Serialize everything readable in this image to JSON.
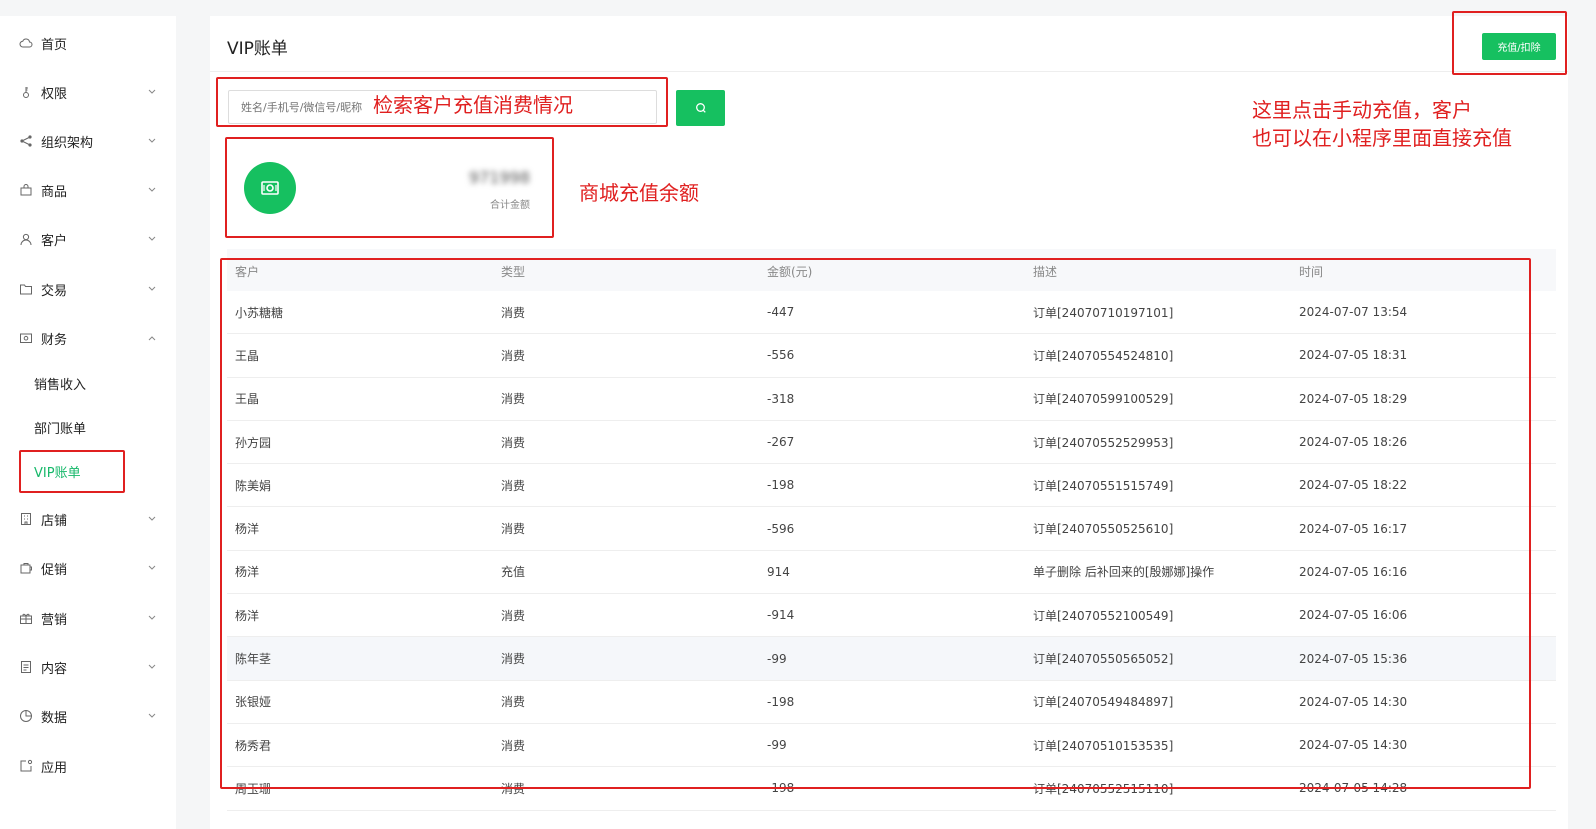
{
  "sidebar": {
    "items": [
      {
        "label": "首页",
        "icon": "cloud-icon",
        "expandable": false
      },
      {
        "label": "权限",
        "icon": "key-icon",
        "expandable": true
      },
      {
        "label": "组织架构",
        "icon": "share-icon",
        "expandable": true
      },
      {
        "label": "商品",
        "icon": "bag-icon",
        "expandable": true
      },
      {
        "label": "客户",
        "icon": "user-icon",
        "expandable": true
      },
      {
        "label": "交易",
        "icon": "folder-icon",
        "expandable": true
      },
      {
        "label": "财务",
        "icon": "wallet-icon",
        "expandable": true,
        "expanded": true
      },
      {
        "label": "店铺",
        "icon": "building-icon",
        "expandable": true
      },
      {
        "label": "促销",
        "icon": "promo-icon",
        "expandable": true
      },
      {
        "label": "营销",
        "icon": "gift-icon",
        "expandable": true
      },
      {
        "label": "内容",
        "icon": "document-icon",
        "expandable": true
      },
      {
        "label": "数据",
        "icon": "pie-chart-icon",
        "expandable": true
      },
      {
        "label": "应用",
        "icon": "app-icon",
        "expandable": false
      }
    ],
    "finance_sub": [
      "销售收入",
      "部门账单",
      "VIP账单"
    ]
  },
  "header": {
    "title": "VIP账单",
    "recharge_button": "充值/扣除"
  },
  "search": {
    "placeholder": "姓名/手机号/微信号/昵称"
  },
  "stat": {
    "value": "971998",
    "label": "合计金额"
  },
  "table": {
    "columns": [
      "客户",
      "类型",
      "金额(元)",
      "描述",
      "时间"
    ],
    "rows": [
      [
        "小苏糖糖",
        "消费",
        "-447",
        "订单[24070710197101]",
        "2024-07-07 13:54"
      ],
      [
        "王晶",
        "消费",
        "-556",
        "订单[24070554524810]",
        "2024-07-05 18:31"
      ],
      [
        "王晶",
        "消费",
        "-318",
        "订单[24070599100529]",
        "2024-07-05 18:29"
      ],
      [
        "孙方园",
        "消费",
        "-267",
        "订单[24070552529953]",
        "2024-07-05 18:26"
      ],
      [
        "陈美娟",
        "消费",
        "-198",
        "订单[24070551515749]",
        "2024-07-05 18:22"
      ],
      [
        "杨洋",
        "消费",
        "-596",
        "订单[24070550525610]",
        "2024-07-05 16:17"
      ],
      [
        "杨洋",
        "充值",
        "914",
        "单子删除 后补回来的[殷娜娜]操作",
        "2024-07-05 16:16"
      ],
      [
        "杨洋",
        "消费",
        "-914",
        "订单[24070552100549]",
        "2024-07-05 16:06"
      ],
      [
        "陈年茎",
        "消费",
        "-99",
        "订单[24070550565052]",
        "2024-07-05 15:36"
      ],
      [
        "张银娅",
        "消费",
        "-198",
        "订单[24070549484897]",
        "2024-07-05 14:30"
      ],
      [
        "杨秀君",
        "消费",
        "-99",
        "订单[24070510153535]",
        "2024-07-05 14:30"
      ],
      [
        "周玉珊",
        "消费",
        "-198",
        "订单[24070552515110]",
        "2024-07-05 14:28"
      ]
    ]
  },
  "annotations": {
    "search_note": "检索客户充值消费情况",
    "balance_note": "商城充值余额",
    "recharge_note_line1": "这里点击手动充值，客户",
    "recharge_note_line2": "也可以在小程序里面直接充值"
  },
  "colors": {
    "accent": "#16c060",
    "annotation": "#e02020"
  }
}
